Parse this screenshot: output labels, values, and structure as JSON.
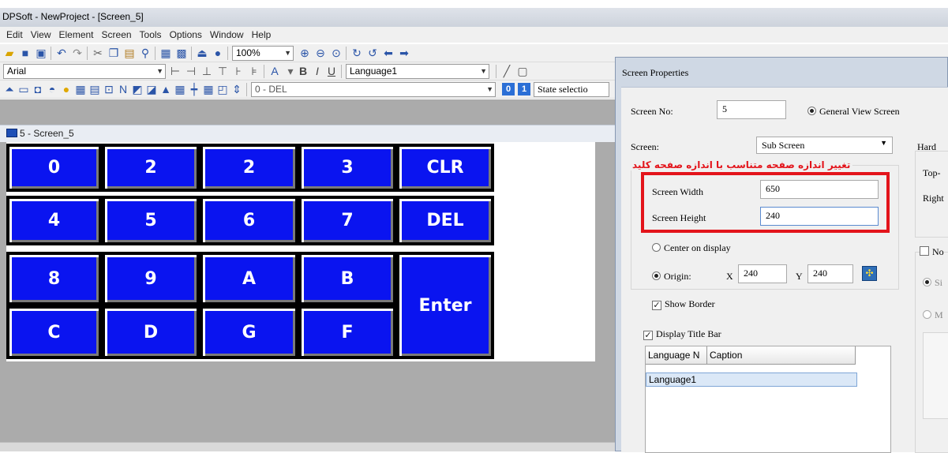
{
  "window": {
    "title": "DPSoft - NewProject - [Screen_5]"
  },
  "menu": [
    "Edit",
    "View",
    "Element",
    "Screen",
    "Tools",
    "Options",
    "Window",
    "Help"
  ],
  "toolbar": {
    "zoom": "100%",
    "font": "Arial",
    "language": "Language1",
    "state_combo": "0 - DEL",
    "state_selection": "State selectio",
    "state_btn_0": "0",
    "state_btn_1": "1"
  },
  "screen_tab": {
    "label": "5 - Screen_5"
  },
  "keypad": {
    "keys": [
      {
        "label": "0"
      },
      {
        "label": "2"
      },
      {
        "label": "2"
      },
      {
        "label": "3"
      },
      {
        "label": "CLR"
      },
      {
        "label": "4"
      },
      {
        "label": "5"
      },
      {
        "label": "6"
      },
      {
        "label": "7"
      },
      {
        "label": "DEL"
      },
      {
        "label": "8"
      },
      {
        "label": "9"
      },
      {
        "label": "A"
      },
      {
        "label": "B"
      },
      {
        "label": "Enter"
      },
      {
        "label": "C"
      },
      {
        "label": "D"
      },
      {
        "label": "G"
      },
      {
        "label": "F"
      }
    ],
    "key_color": "#0a14f0"
  },
  "dialog": {
    "title": "Screen Properties",
    "screen_no_label": "Screen No:",
    "screen_no_value": "5",
    "general_view": "General View Screen",
    "screen_label": "Screen:",
    "screen_type": "Sub Screen",
    "hard_label": "Hard",
    "top_label": "Top-",
    "right_label": "Right",
    "note": "تغییر اندازه صفحه متناسب با اندازه صفحه کلید",
    "width_label": "Screen Width",
    "width_value": "650",
    "height_label": "Screen Height",
    "height_value": "240",
    "center_label": "Center on display",
    "origin_label": "Origin:",
    "x_label": "X",
    "x_value": "240",
    "y_label": "Y",
    "y_value": "240",
    "show_border": "Show Border",
    "display_title_bar": "Display Title Bar",
    "n_label": "No",
    "si_label": "Si",
    "m_label": "M",
    "table_headers": [
      "Language N",
      "Caption"
    ],
    "table_rows": [
      "Language1"
    ],
    "accent": "#e3141b"
  }
}
